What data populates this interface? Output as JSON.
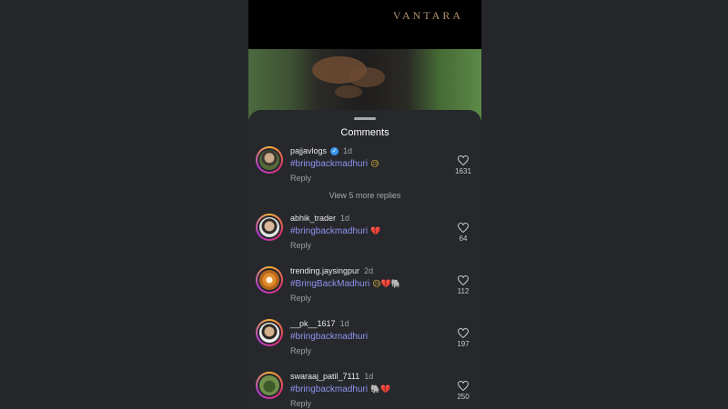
{
  "video": {
    "brand": "VANTARA"
  },
  "sheet": {
    "title": "Comments",
    "view_more": "View 5 more replies"
  },
  "colors": {
    "hashtag": "#8f93ee",
    "sheet_bg": "#26282c",
    "verified": "#3897f0"
  },
  "comments": [
    {
      "username": "pajjavlogs",
      "verified": true,
      "time": "1d",
      "text": "#bringbackmadhuri",
      "emoji": "😥",
      "reply": "Reply",
      "likes": "1631"
    },
    {
      "username": "abhik_trader",
      "verified": false,
      "time": "1d",
      "text": "#bringbackmadhuri",
      "emoji": "💔",
      "reply": "Reply",
      "likes": "64"
    },
    {
      "username": "trending.jaysingpur",
      "verified": false,
      "time": "2d",
      "text": "#BringBackMadhuri",
      "emoji": "😥💔🐘",
      "reply": "Reply",
      "likes": "112"
    },
    {
      "username": "__pk__1617",
      "verified": false,
      "time": "1d",
      "text": "#bringbackmadhuri",
      "emoji": "",
      "reply": "Reply",
      "likes": "197"
    },
    {
      "username": "swaraaj_patil_7111",
      "verified": false,
      "time": "1d",
      "text": "#bringbackmadhuri",
      "emoji": "🐘💔",
      "reply": "Reply",
      "likes": "250"
    }
  ]
}
